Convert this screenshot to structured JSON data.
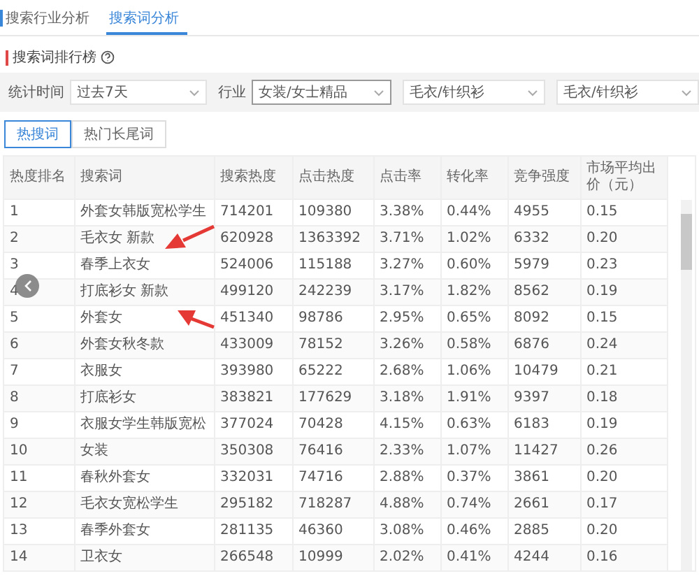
{
  "tabs": [
    {
      "label": "搜索行业分析",
      "selected": false
    },
    {
      "label": "搜索词分析",
      "selected": true
    }
  ],
  "heading": "搜索词排行榜",
  "filters": [
    {
      "label": "统计时间",
      "value": "过去7天",
      "focused": false
    },
    {
      "label": "行业",
      "value": "女装/女士精品",
      "focused": true
    },
    {
      "value": "毛衣/针织衫",
      "focused": false
    },
    {
      "value": "毛衣/针织衫",
      "focused": false
    }
  ],
  "sub_tabs": [
    {
      "label": "热搜词",
      "selected": true
    },
    {
      "label": "热门长尾词",
      "selected": false
    }
  ],
  "table": {
    "columns": [
      "热度排名",
      "搜索词",
      "搜索热度",
      "点击热度",
      "点击率",
      "转化率",
      "竞争强度",
      "市场平均出价（元）"
    ],
    "rows": [
      [
        "1",
        "外套女韩版宽松学生",
        "714201",
        "109380",
        "3.38%",
        "0.44%",
        "4955",
        "0.15"
      ],
      [
        "2",
        "毛衣女 新款",
        "620928",
        "1363392",
        "3.71%",
        "1.02%",
        "6332",
        "0.20"
      ],
      [
        "3",
        "春季上衣女",
        "524006",
        "115188",
        "3.27%",
        "0.60%",
        "5979",
        "0.23"
      ],
      [
        "4",
        "打底衫女 新款",
        "499120",
        "242239",
        "3.17%",
        "1.82%",
        "8562",
        "0.19"
      ],
      [
        "5",
        "外套女",
        "451340",
        "98786",
        "2.95%",
        "0.65%",
        "8092",
        "0.15"
      ],
      [
        "6",
        "外套女秋冬款",
        "433009",
        "78152",
        "3.26%",
        "0.58%",
        "6876",
        "0.24"
      ],
      [
        "7",
        "衣服女",
        "393980",
        "65222",
        "2.68%",
        "1.06%",
        "10479",
        "0.21"
      ],
      [
        "8",
        "打底衫女",
        "383821",
        "177629",
        "3.18%",
        "1.91%",
        "9397",
        "0.18"
      ],
      [
        "9",
        "衣服女学生韩版宽松",
        "377024",
        "70428",
        "4.15%",
        "0.63%",
        "6183",
        "0.19"
      ],
      [
        "10",
        "女装",
        "350308",
        "76416",
        "2.33%",
        "1.07%",
        "11427",
        "0.26"
      ],
      [
        "11",
        "春秋外套女",
        "332031",
        "74716",
        "2.88%",
        "0.37%",
        "3861",
        "0.20"
      ],
      [
        "12",
        "毛衣女宽松学生",
        "295182",
        "718287",
        "4.88%",
        "0.74%",
        "2661",
        "0.17"
      ],
      [
        "13",
        "春季外套女",
        "281135",
        "46360",
        "3.08%",
        "0.46%",
        "2885",
        "0.20"
      ],
      [
        "14",
        "卫衣女",
        "266548",
        "10999",
        "2.02%",
        "0.41%",
        "4244",
        "0.16"
      ]
    ]
  }
}
